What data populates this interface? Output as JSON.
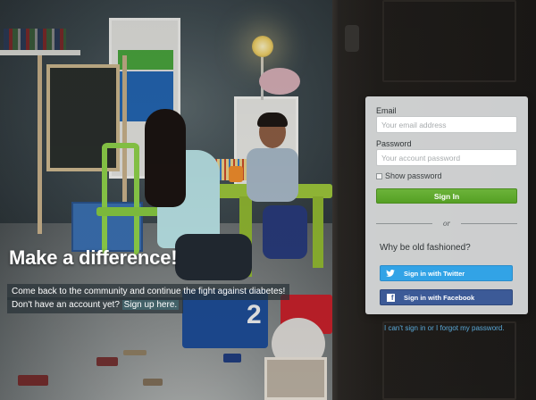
{
  "hero": {
    "title": "Make a difference!",
    "line1": "Come back to the community and continue the fight against diabetes!",
    "line2_prefix": "Don't have an account yet?",
    "signup_link": "Sign up here."
  },
  "form": {
    "email_label": "Email",
    "email_placeholder": "Your email address",
    "email_value": "",
    "password_label": "Password",
    "password_placeholder": "Your account password",
    "password_value": "",
    "show_password_label": "Show password",
    "show_password_checked": false,
    "signin_label": "Sign In",
    "divider_text": "or",
    "alt_heading": "Why be old fashioned?",
    "twitter_label": "Sign in with Twitter",
    "facebook_label": "Sign in with Facebook"
  },
  "help": {
    "cant_sign_in": "I can't sign in",
    "separator": " or ",
    "forgot_password": "I forgot my password."
  },
  "background": {
    "toy_box_number": "2"
  },
  "colors": {
    "signin_green": "#5ca82b",
    "twitter_blue": "#32a3e6",
    "facebook_blue": "#3c5a97",
    "link_blue": "#5aa9d8"
  },
  "icons": {
    "twitter": "twitter-bird-icon",
    "facebook": "facebook-f-icon"
  }
}
